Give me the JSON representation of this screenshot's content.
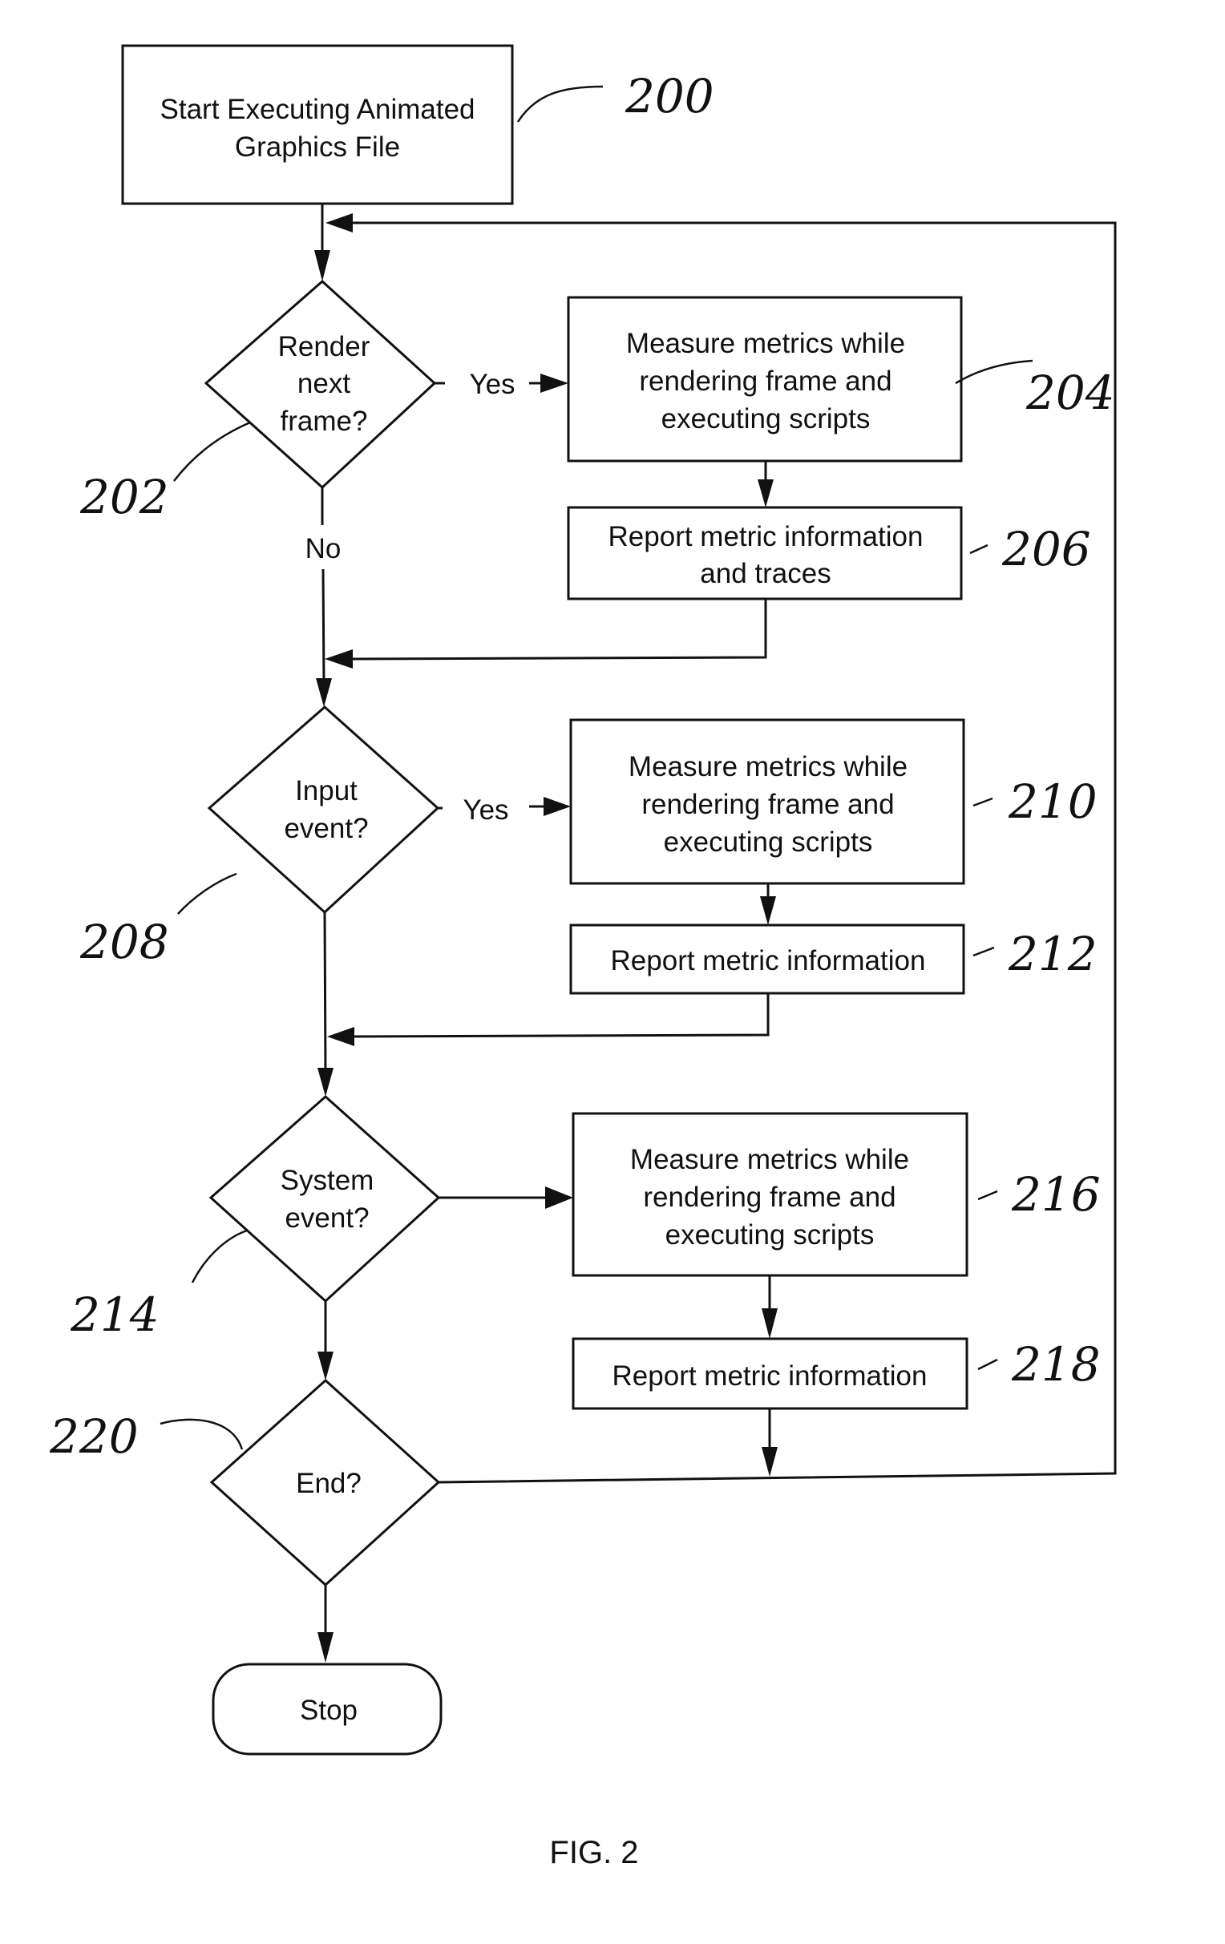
{
  "figure": {
    "caption": "FIG. 2",
    "nodes": [
      {
        "id": "200",
        "type": "process",
        "lines": [
          "Start Executing Animated",
          "Graphics File"
        ],
        "ref": "200"
      },
      {
        "id": "202",
        "type": "decision",
        "lines": [
          "Render",
          "next",
          "frame?"
        ],
        "ref": "202"
      },
      {
        "id": "204",
        "type": "process",
        "lines": [
          "Measure metrics while",
          "rendering frame and",
          "executing scripts"
        ],
        "ref": "204"
      },
      {
        "id": "206",
        "type": "process",
        "lines": [
          "Report metric information",
          "and traces"
        ],
        "ref": "206"
      },
      {
        "id": "208",
        "type": "decision",
        "lines": [
          "Input",
          "event?"
        ],
        "ref": "208"
      },
      {
        "id": "210",
        "type": "process",
        "lines": [
          "Measure metrics while",
          "rendering frame and",
          "executing scripts"
        ],
        "ref": "210"
      },
      {
        "id": "212",
        "type": "process",
        "lines": [
          "Report metric information"
        ],
        "ref": "212"
      },
      {
        "id": "214",
        "type": "decision",
        "lines": [
          "System",
          "event?"
        ],
        "ref": "214"
      },
      {
        "id": "216",
        "type": "process",
        "lines": [
          "Measure metrics while",
          "rendering frame and",
          "executing scripts"
        ],
        "ref": "216"
      },
      {
        "id": "218",
        "type": "process",
        "lines": [
          "Report metric information"
        ],
        "ref": "218"
      },
      {
        "id": "220",
        "type": "decision",
        "lines": [
          "End?"
        ],
        "ref": "220"
      },
      {
        "id": "stop",
        "type": "terminator",
        "lines": [
          "Stop"
        ]
      }
    ],
    "edge_labels": {
      "d202_yes": "Yes",
      "d202_no": "No",
      "d208_yes": "Yes"
    },
    "edges": [
      {
        "from": "200",
        "to": "202"
      },
      {
        "from": "202",
        "to": "204",
        "label": "Yes"
      },
      {
        "from": "204",
        "to": "206"
      },
      {
        "from": "206",
        "to": "208"
      },
      {
        "from": "202",
        "to": "208",
        "label": "No"
      },
      {
        "from": "208",
        "to": "210",
        "label": "Yes"
      },
      {
        "from": "210",
        "to": "212"
      },
      {
        "from": "212",
        "to": "214"
      },
      {
        "from": "208",
        "to": "214"
      },
      {
        "from": "214",
        "to": "216"
      },
      {
        "from": "216",
        "to": "218"
      },
      {
        "from": "218",
        "to": "220"
      },
      {
        "from": "214",
        "to": "220"
      },
      {
        "from": "220",
        "to": "202"
      },
      {
        "from": "220",
        "to": "stop"
      }
    ]
  }
}
